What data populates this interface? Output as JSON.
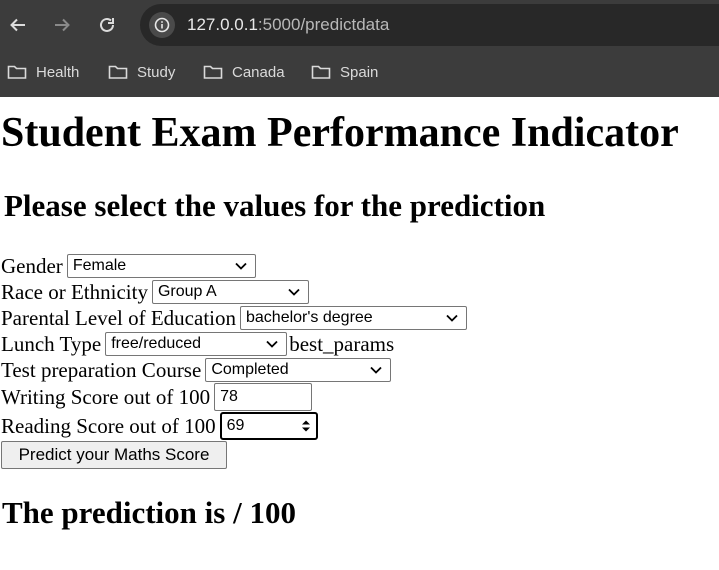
{
  "browser": {
    "url_host": "127.0.0.1",
    "url_path": ":5000/predictdata",
    "bookmarks": [
      "Health",
      "Study",
      "Canada",
      "Spain"
    ]
  },
  "page": {
    "title": "Student Exam Performance Indicator",
    "subtitle": "Please select the values for the prediction"
  },
  "form": {
    "gender": {
      "label": "Gender",
      "value": "Female"
    },
    "race": {
      "label": "Race or Ethnicity",
      "value": "Group A"
    },
    "parental_education": {
      "label": "Parental Level of Education",
      "value": "bachelor's degree"
    },
    "lunch": {
      "label": "Lunch Type",
      "value": "free/reduced",
      "trailing_text": "best_params"
    },
    "test_prep": {
      "label": "Test preparation Course",
      "value": "Completed"
    },
    "writing_score": {
      "label": "Writing Score out of 100",
      "value": "78"
    },
    "reading_score": {
      "label": "Reading Score out of 100",
      "value": "69"
    },
    "submit_label": "Predict your Maths Score"
  },
  "result": {
    "text": "The prediction is / 100"
  }
}
